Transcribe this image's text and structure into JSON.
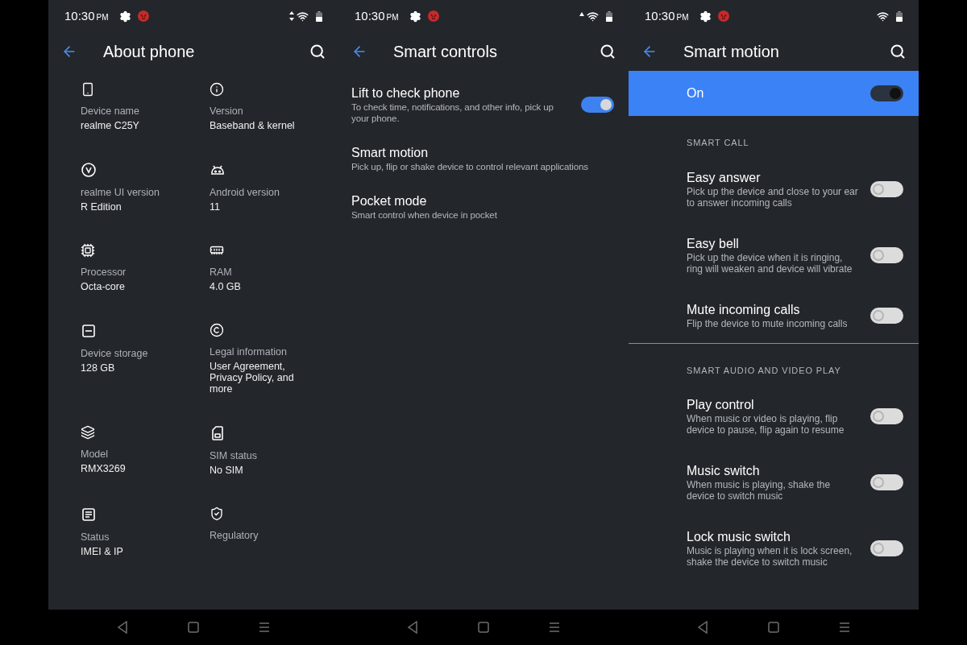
{
  "about_phone": {
    "status_bar": {
      "time": "10:30",
      "ampm": "PM"
    },
    "title": "About phone",
    "items": [
      {
        "label": "Device name",
        "value": "realme C25Y"
      },
      {
        "label": "Version",
        "value": "Baseband & kernel"
      },
      {
        "label": "realme UI version",
        "value": "R Edition"
      },
      {
        "label": "Android version",
        "value": "11"
      },
      {
        "label": "Processor",
        "value": "Octa-core"
      },
      {
        "label": "RAM",
        "value": "4.0 GB"
      },
      {
        "label": "Device storage",
        "value": "128 GB"
      },
      {
        "label": "Legal information",
        "value": "User Agreement, Privacy Policy, and more"
      },
      {
        "label": "Model",
        "value": "RMX3269"
      },
      {
        "label": "SIM status",
        "value": "No SIM"
      },
      {
        "label": "Status",
        "value": "IMEI & IP"
      },
      {
        "label": "Regulatory"
      }
    ]
  },
  "smart_controls": {
    "status_bar": {
      "time": "10:30",
      "ampm": "PM"
    },
    "title": "Smart controls",
    "items": [
      {
        "kind": "switch",
        "title": "Lift to check phone",
        "description": "To check time, notifications, and other info, pick up your phone.",
        "on": true
      },
      {
        "kind": "link",
        "title": "Smart motion",
        "description": "Pick up, flip or shake device to control relevant applications"
      },
      {
        "kind": "link",
        "title": "Pocket mode",
        "description": "Smart control when device in pocket"
      }
    ]
  },
  "smart_motion": {
    "status_bar": {
      "time": "10:30",
      "ampm": "PM"
    },
    "title": "Smart motion",
    "master": {
      "label": "On",
      "on": true
    },
    "sections": [
      {
        "heading": "SMART CALL",
        "items": [
          {
            "title": "Easy answer",
            "description": "Pick up the device and close to your ear to answer incoming calls",
            "on": false
          },
          {
            "title": "Easy bell",
            "description": "Pick up the device when it is ringing, ring will weaken and device will vibrate",
            "on": false
          },
          {
            "title": "Mute incoming calls",
            "description": "Flip the device to mute incoming calls",
            "on": false
          }
        ]
      },
      {
        "heading": "SMART AUDIO AND VIDEO PLAY",
        "items": [
          {
            "title": "Play control",
            "description": "When music or video is playing, flip device to pause, flip again to resume",
            "on": false
          },
          {
            "title": "Music switch",
            "description": "When music is playing, shake the device to switch music",
            "on": false
          },
          {
            "title": "Lock music switch",
            "description": "Music is playing when it is lock screen, shake the device to switch music",
            "on": false
          }
        ]
      }
    ]
  }
}
